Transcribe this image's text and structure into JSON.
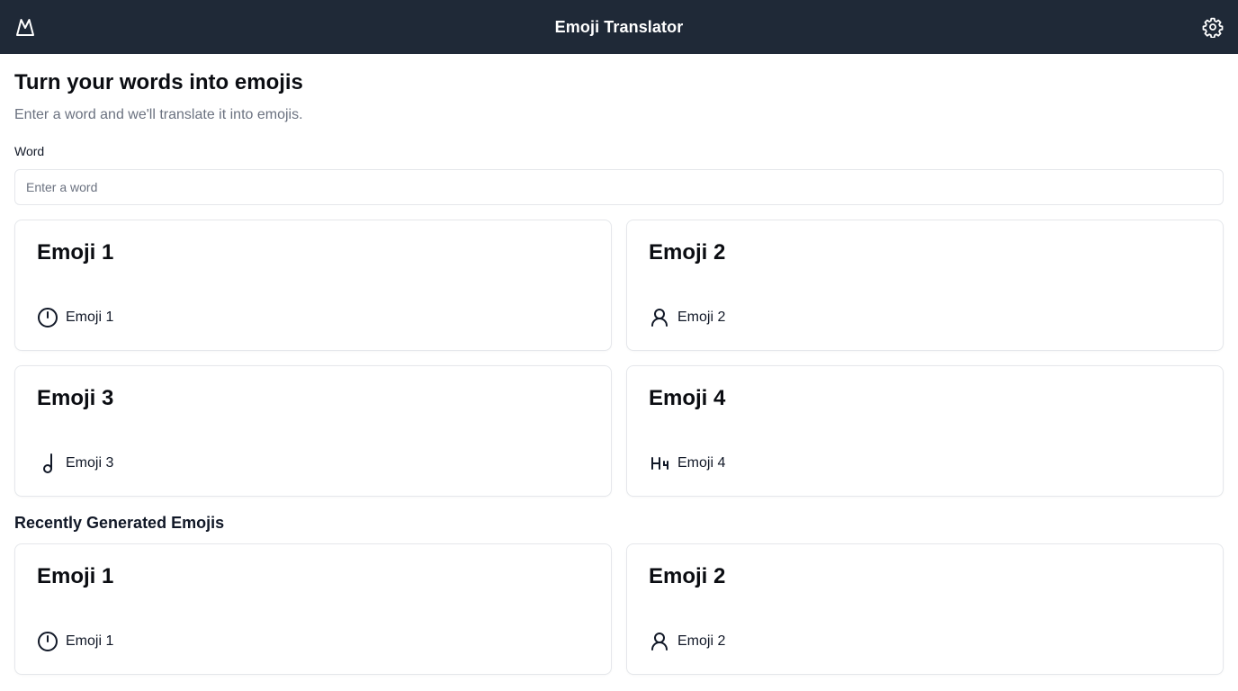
{
  "header": {
    "title": "Emoji Translator",
    "logo_icon": "mountain-logo-icon",
    "settings_icon": "gear-icon",
    "background": "#1f2937"
  },
  "hero": {
    "headline": "Turn your words into emojis",
    "subheadline": "Enter a word and we'll translate it into emojis."
  },
  "form": {
    "label": "Word",
    "value": "",
    "placeholder": "Enter a word"
  },
  "results": [
    {
      "title": "Emoji 1",
      "label": "Emoji 1",
      "icon": "timer-icon"
    },
    {
      "title": "Emoji 2",
      "label": "Emoji 2",
      "icon": "user-icon"
    },
    {
      "title": "Emoji 3",
      "label": "Emoji 3",
      "icon": "music-note-icon"
    },
    {
      "title": "Emoji 4",
      "label": "Emoji 4",
      "icon": "heading-4-icon"
    }
  ],
  "recent": {
    "title": "Recently Generated Emojis",
    "items": [
      {
        "title": "Emoji 1",
        "label": "Emoji 1",
        "icon": "timer-icon"
      },
      {
        "title": "Emoji 2",
        "label": "Emoji 2",
        "icon": "user-icon"
      }
    ]
  }
}
